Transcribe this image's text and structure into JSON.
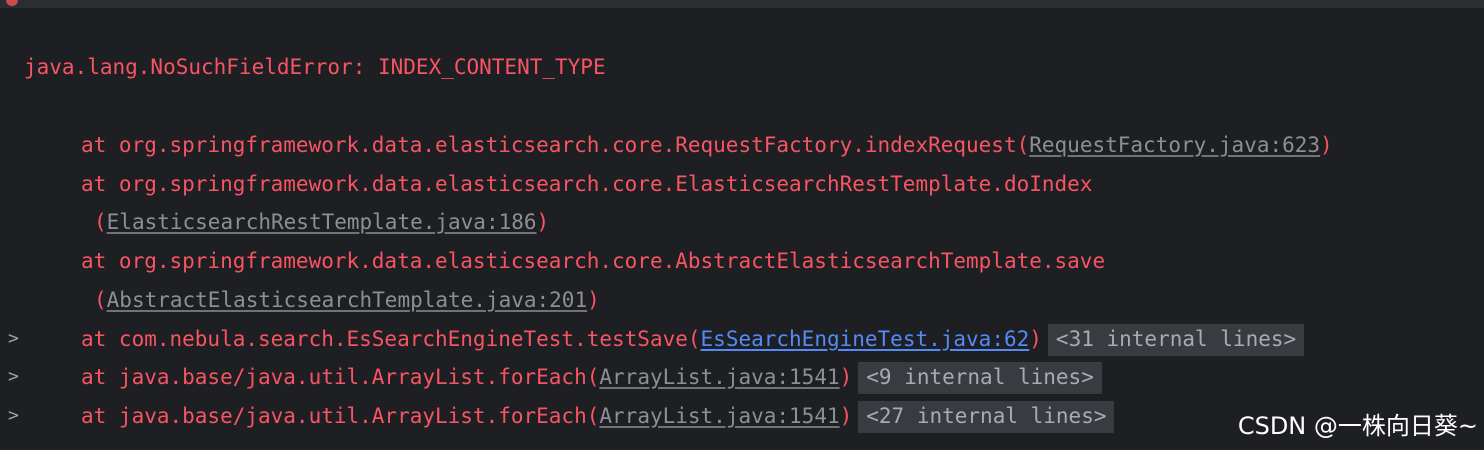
{
  "error_line": "java.lang.NoSuchFieldError: INDEX_CONTENT_TYPE",
  "frames": [
    {
      "text": "at org.springframework.data.elasticsearch.core.RequestFactory.indexRequest",
      "link": "RequestFactory.java:623"
    },
    {
      "text": "at org.springframework.data.elasticsearch.core.ElasticsearchRestTemplate.doIndex",
      "link": "ElasticsearchRestTemplate.java:186"
    },
    {
      "text": "at org.springframework.data.elasticsearch.core.AbstractElasticsearchTemplate.save",
      "link": "AbstractElasticsearchTemplate.java:201"
    },
    {
      "text": "at com.nebula.search.EsSearchEngineTest.testSave",
      "link": "EsSearchEngineTest.java:62",
      "internal": "<31 internal lines>"
    },
    {
      "text": "at java.base/java.util.ArrayList.forEach",
      "link": "ArrayList.java:1541",
      "internal": "<9 internal lines>"
    },
    {
      "text": "at java.base/java.util.ArrayList.forEach",
      "link": "ArrayList.java:1541",
      "internal": "<27 internal lines>"
    }
  ],
  "paren_open": "(",
  "paren_close": ")",
  "fold_icon": ">",
  "watermark": "CSDN @一株向日葵~"
}
